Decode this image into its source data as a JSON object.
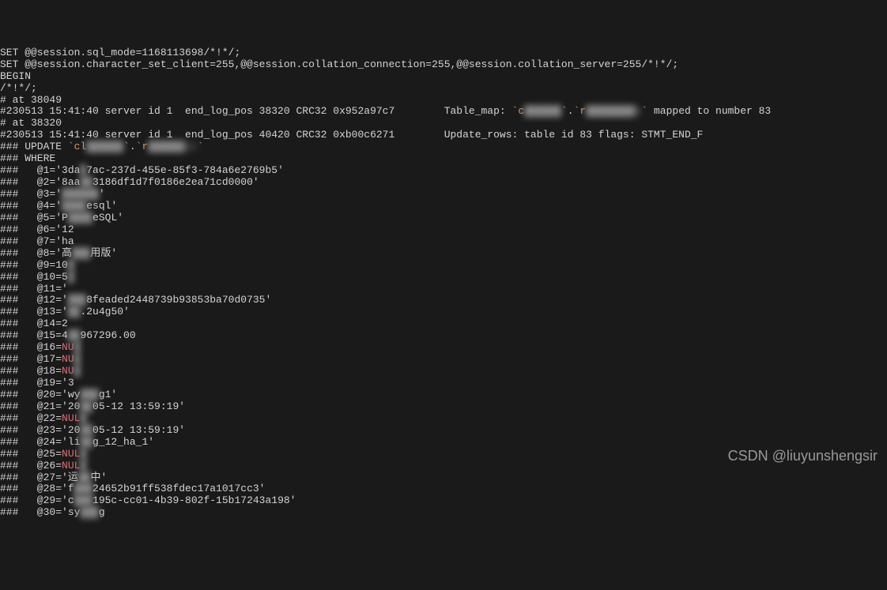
{
  "lines": [
    {
      "parts": [
        {
          "t": "SET @@session.sql_mode=1168113698/*!*/;"
        }
      ]
    },
    {
      "parts": [
        {
          "t": "SET @@session.character_set_client=255,@@session.collation_connection=255,@@session.collation_server=255/*!*/;"
        }
      ]
    },
    {
      "parts": [
        {
          "t": "BEGIN"
        }
      ]
    },
    {
      "parts": [
        {
          "t": "/*!*/;"
        }
      ]
    },
    {
      "parts": [
        {
          "t": "# at 38049"
        }
      ]
    },
    {
      "parts": [
        {
          "t": "#230513 15:41:40 server id 1  end_log_pos 38320 CRC32 0x952a97c7        Table_map: "
        },
        {
          "t": "`c",
          "cls": "orange"
        },
        {
          "t": "██████",
          "cls": "redacted"
        },
        {
          "t": "`",
          "cls": "orange"
        },
        {
          "t": "."
        },
        {
          "t": "`r",
          "cls": "orange"
        },
        {
          "t": "████████e",
          "cls": "redacted"
        },
        {
          "t": "`",
          "cls": "orange"
        },
        {
          "t": " mapped to number 83"
        }
      ]
    },
    {
      "parts": [
        {
          "t": "# at 38320"
        }
      ]
    },
    {
      "parts": [
        {
          "t": "#230513 15:41:40 server id 1  end_log_pos 40420 CRC32 0xb00c6271        Update_rows: table id 83 flags: STMT_END_F"
        }
      ]
    },
    {
      "parts": [
        {
          "t": "### UPDATE "
        },
        {
          "t": "`cl",
          "cls": "orange"
        },
        {
          "t": "██████",
          "cls": "redacted"
        },
        {
          "t": "`",
          "cls": "orange"
        },
        {
          "t": "."
        },
        {
          "t": "`r",
          "cls": "orange"
        },
        {
          "t": "██████ce",
          "cls": "redacted"
        },
        {
          "t": "`",
          "cls": "orange"
        }
      ]
    },
    {
      "parts": [
        {
          "t": "### WHERE"
        }
      ]
    },
    {
      "parts": [
        {
          "t": "###   @1='3da"
        },
        {
          "t": "█",
          "cls": "redacted"
        },
        {
          "t": "7ac-237d-455e-85f3-784a6e2769b5'"
        }
      ]
    },
    {
      "parts": [
        {
          "t": "###   @2='8aa"
        },
        {
          "t": "██",
          "cls": "redacted"
        },
        {
          "t": "3186df1d7f0186e2ea71cd0000'"
        }
      ]
    },
    {
      "parts": [
        {
          "t": "###   @3='"
        },
        {
          "t": "██████",
          "cls": "redacted"
        },
        {
          "t": "'"
        }
      ]
    },
    {
      "parts": [
        {
          "t": "###   @4='"
        },
        {
          "t": "████",
          "cls": "redacted"
        },
        {
          "t": "esql'"
        }
      ]
    },
    {
      "parts": [
        {
          "t": "###   @5='P"
        },
        {
          "t": "████",
          "cls": "redacted"
        },
        {
          "t": "eSQL'"
        }
      ]
    },
    {
      "parts": [
        {
          "t": "###   @6='12"
        },
        {
          "t": "",
          "cls": "redacted"
        }
      ]
    },
    {
      "parts": [
        {
          "t": "###   @7='ha"
        },
        {
          "t": "",
          "cls": "redacted"
        }
      ]
    },
    {
      "parts": [
        {
          "t": "###   @8='高"
        },
        {
          "t": "███",
          "cls": "redacted"
        },
        {
          "t": "用版'"
        }
      ]
    },
    {
      "parts": [
        {
          "t": "###   @9=10"
        },
        {
          "t": "█",
          "cls": "redacted"
        }
      ]
    },
    {
      "parts": [
        {
          "t": "###   @10=5"
        },
        {
          "t": "█",
          "cls": "redacted"
        }
      ]
    },
    {
      "parts": [
        {
          "t": "###   @11='"
        },
        {
          "t": "",
          "cls": "redacted"
        }
      ]
    },
    {
      "parts": [
        {
          "t": "###   @12='"
        },
        {
          "t": "███",
          "cls": "redacted"
        },
        {
          "t": "8feaded2448739b93853ba70d0735'"
        }
      ]
    },
    {
      "parts": [
        {
          "t": "###   @13='"
        },
        {
          "t": "██",
          "cls": "redacted"
        },
        {
          "t": ".2u4g50'"
        }
      ]
    },
    {
      "parts": [
        {
          "t": "###   @14=2"
        },
        {
          "t": "",
          "cls": "redacted"
        }
      ]
    },
    {
      "parts": [
        {
          "t": "###   @15=4"
        },
        {
          "t": "██",
          "cls": "redacted"
        },
        {
          "t": "967296.00"
        }
      ]
    },
    {
      "parts": [
        {
          "t": "###   @16="
        },
        {
          "t": "NU",
          "cls": "pink"
        },
        {
          "t": "█",
          "cls": "redacted"
        }
      ]
    },
    {
      "parts": [
        {
          "t": "###   @17="
        },
        {
          "t": "NU",
          "cls": "pink"
        },
        {
          "t": "█",
          "cls": "redacted"
        }
      ]
    },
    {
      "parts": [
        {
          "t": "###   @18="
        },
        {
          "t": "NU",
          "cls": "pink"
        },
        {
          "t": "█",
          "cls": "redacted"
        }
      ]
    },
    {
      "parts": [
        {
          "t": "###   @19='3"
        },
        {
          "t": "",
          "cls": "redacted"
        }
      ]
    },
    {
      "parts": [
        {
          "t": "###   @20='wy"
        },
        {
          "t": "███",
          "cls": "redacted"
        },
        {
          "t": "g1'"
        }
      ]
    },
    {
      "parts": [
        {
          "t": "###   @21='20"
        },
        {
          "t": "██",
          "cls": "redacted"
        },
        {
          "t": "05-12 13:59:19'"
        }
      ]
    },
    {
      "parts": [
        {
          "t": "###   @22="
        },
        {
          "t": "NUL",
          "cls": "pink"
        },
        {
          "t": "█",
          "cls": "redacted"
        }
      ]
    },
    {
      "parts": [
        {
          "t": "###   @23='20"
        },
        {
          "t": "██",
          "cls": "redacted"
        },
        {
          "t": "05-12 13:59:19'"
        }
      ]
    },
    {
      "parts": [
        {
          "t": "###   @24='li"
        },
        {
          "t": "██",
          "cls": "redacted"
        },
        {
          "t": "g_12_ha_1'"
        }
      ]
    },
    {
      "parts": [
        {
          "t": "###   @25="
        },
        {
          "t": "NUL",
          "cls": "pink"
        },
        {
          "t": "█",
          "cls": "redacted"
        }
      ]
    },
    {
      "parts": [
        {
          "t": "###   @26="
        },
        {
          "t": "NUL",
          "cls": "pink"
        },
        {
          "t": "█",
          "cls": "redacted"
        }
      ]
    },
    {
      "parts": [
        {
          "t": "###   @27='运"
        },
        {
          "t": "██",
          "cls": "redacted"
        },
        {
          "t": "中'"
        }
      ]
    },
    {
      "parts": [
        {
          "t": "###   @28='f"
        },
        {
          "t": "███",
          "cls": "redacted"
        },
        {
          "t": "24652b91ff538fdec17a1017cc3'"
        }
      ]
    },
    {
      "parts": [
        {
          "t": "###   @29='c"
        },
        {
          "t": "███",
          "cls": "redacted"
        },
        {
          "t": "195c-cc01-4b39-802f-15b17243a198'"
        }
      ]
    },
    {
      "parts": [
        {
          "t": "###   @30='sy"
        },
        {
          "t": "███",
          "cls": "redacted"
        },
        {
          "t": "g"
        }
      ]
    }
  ],
  "watermark": "CSDN @liuyunshengsir"
}
